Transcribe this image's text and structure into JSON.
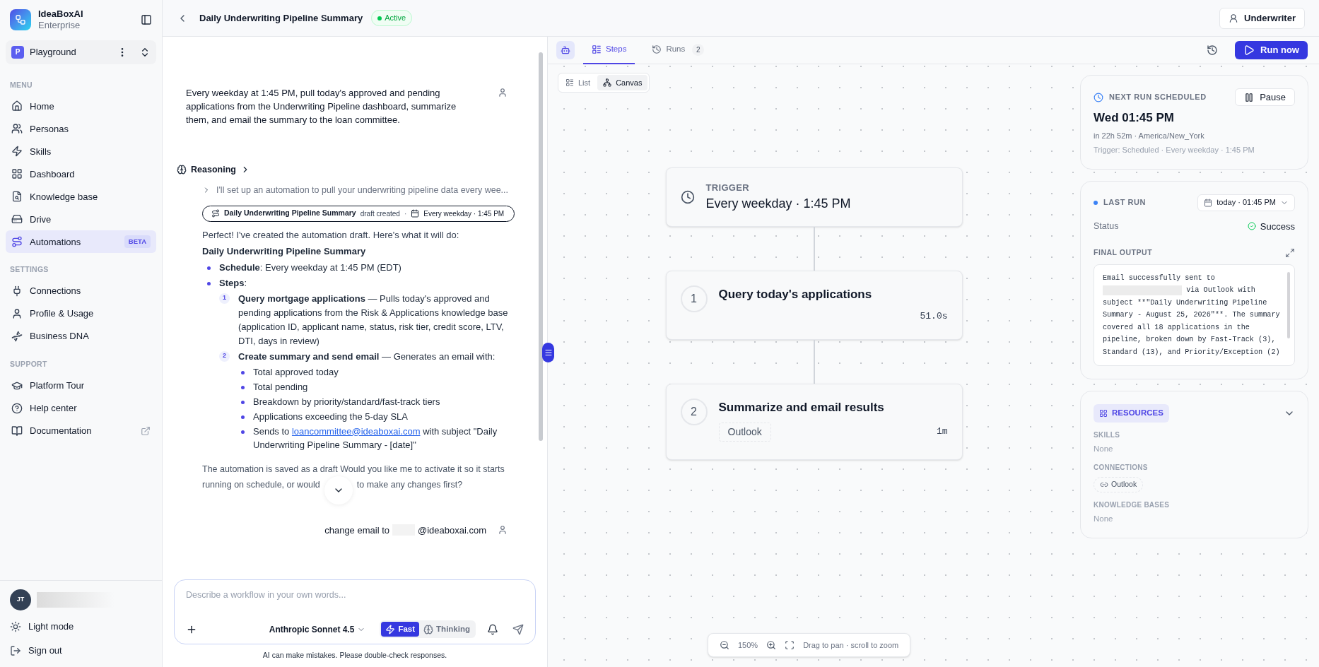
{
  "brand": {
    "name": "IdeaBoxAI",
    "plan": "Enterprise"
  },
  "workspace": {
    "initial": "P",
    "name": "Playground"
  },
  "sidebar": {
    "sections": [
      {
        "title": "MENU",
        "items": [
          {
            "label": "Home",
            "selected": false,
            "external": false
          },
          {
            "label": "Personas",
            "selected": false,
            "external": false
          },
          {
            "label": "Skills",
            "selected": false,
            "external": false
          },
          {
            "label": "Dashboard",
            "selected": false,
            "external": false
          },
          {
            "label": "Knowledge base",
            "selected": false,
            "external": false
          },
          {
            "label": "Drive",
            "selected": false,
            "external": false
          },
          {
            "label": "Automations",
            "selected": true,
            "external": false,
            "badge": "BETA"
          }
        ]
      },
      {
        "title": "SETTINGS",
        "items": [
          {
            "label": "Connections",
            "selected": false,
            "external": false
          },
          {
            "label": "Profile & Usage",
            "selected": false,
            "external": false
          },
          {
            "label": "Business DNA",
            "selected": false,
            "external": false
          }
        ]
      },
      {
        "title": "SUPPORT",
        "items": [
          {
            "label": "Platform Tour",
            "selected": false,
            "external": false
          },
          {
            "label": "Help center",
            "selected": false,
            "external": false
          },
          {
            "label": "Documentation",
            "selected": false,
            "external": true
          }
        ]
      }
    ]
  },
  "user": {
    "initials": "JT"
  },
  "sidebar_footer": [
    {
      "label": "Light mode"
    },
    {
      "label": "Sign out"
    }
  ],
  "header": {
    "title": "Daily Underwriting Pipeline Summary",
    "status": "Active",
    "role_button": "Underwriter"
  },
  "chat": {
    "user_message": "Every weekday at 1:45 PM, pull today's approved and pending applications from the Underwriting Pipeline dashboard, summarize them, and email the summary to the loan committee.",
    "reasoning": {
      "label": "Reasoning",
      "summary": "I'll set up an automation to pull your underwriting pipeline data every wee..."
    },
    "draft_pill": {
      "name": "Daily Underwriting Pipeline Summary",
      "status": "draft created",
      "separator": "·",
      "schedule": "Every weekday · 1:45 PM"
    },
    "intro": "Perfect! I've created the automation draft. Here's what it will do:",
    "heading": "Daily Underwriting Pipeline Summary",
    "bullets": [
      {
        "text": "**Schedule**: Every weekday at 1:45 PM (EDT)"
      },
      {
        "text": "**Steps**:",
        "steps": [
          {
            "number": "1",
            "text": "**Query mortgage applications** — Pulls today's approved and pending applications from the Risk & Applications knowledge base (application ID, applicant name, status, risk tier, credit score, LTV, DTI, days in review)"
          },
          {
            "number": "2",
            "text": "**Create summary and send email** — Generates an email with:",
            "items": [
              {
                "kind": "text",
                "text": "Total approved today"
              },
              {
                "kind": "text",
                "text": "Total pending"
              },
              {
                "kind": "text",
                "text": "Breakdown by priority/standard/fast-track tiers"
              },
              {
                "kind": "text",
                "text": "Applications exceeding the 5-day SLA"
              },
              {
                "kind": "link",
                "before": "Sends to",
                "link": "loancommittee@ideaboxai.com",
                "after": "with subject \"Daily Underwriting Pipeline Summary - [date]\""
              }
            ]
          }
        ]
      }
    ],
    "closing_before": "The automation is saved as a draft Would you like me to activate it so it starts running on schedule, or would",
    "closing_after": "to make any changes first?",
    "followup": {
      "before": "change email to",
      "after": "@ideaboxai.com"
    }
  },
  "composer": {
    "placeholder": "Describe a workflow in your own words...",
    "model": "Anthropic Sonnet 4.5",
    "modes": [
      {
        "label": "Fast",
        "selected": true
      },
      {
        "label": "Thinking",
        "selected": false
      }
    ],
    "disclaimer": "AI can make mistakes. Please double-check responses."
  },
  "workflow": {
    "tabs": [
      {
        "label": "Steps",
        "selected": true
      },
      {
        "label": "Runs",
        "count": "2",
        "selected": false
      }
    ],
    "run_button": "Run now",
    "views": [
      {
        "label": "List",
        "selected": false
      },
      {
        "label": "Canvas",
        "selected": true
      }
    ],
    "trigger": {
      "label": "TRIGGER",
      "schedule": "Every weekday · 1:45 PM"
    },
    "steps": [
      {
        "number": "1",
        "title": "Query today's applications",
        "duration": "51.0s"
      },
      {
        "number": "2",
        "title": "Summarize and email results",
        "connection": "Outlook",
        "duration": "1m"
      }
    ],
    "zoom": {
      "percent": "150%",
      "hint": "Drag to pan · scroll to zoom"
    }
  },
  "panel": {
    "next_run": {
      "label": "NEXT RUN SCHEDULED",
      "pause": "Pause",
      "time": "Wed 01:45 PM",
      "countdown": "in 22h 52m · America/New_York",
      "trigger": "Trigger: Scheduled · Every weekday · 1:45 PM"
    },
    "last_run": {
      "label": "LAST RUN",
      "run_select": "today · 01:45 PM",
      "status_label": "Status",
      "status": "Success",
      "output_label": "FINAL OUTPUT",
      "output_before": "Email successfully sent to",
      "output_after": "via Outlook with subject **\"Daily Underwriting Pipeline Summary - August 25, 2026\"**. The summary covered all 18 applications in the pipeline, broken down by Fast-Track (3), Standard (13), and Priority/Exception (2)"
    },
    "resources": {
      "label": "RESOURCES",
      "groups": [
        {
          "label": "SKILLS",
          "kind": "empty",
          "value": "None"
        },
        {
          "label": "CONNECTIONS",
          "kind": "chip",
          "value": "Outlook"
        },
        {
          "label": "KNOWLEDGE BASES",
          "kind": "empty",
          "value": "None"
        }
      ]
    }
  }
}
